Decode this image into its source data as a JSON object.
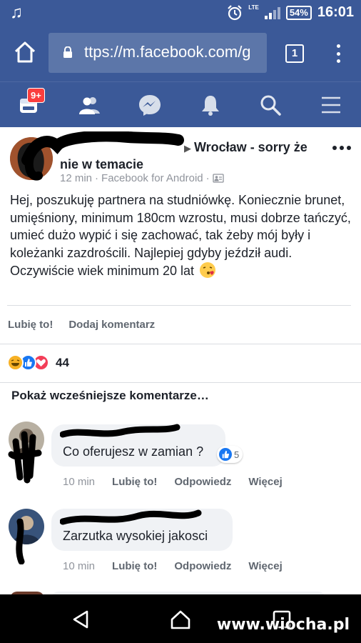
{
  "status_bar": {
    "battery": "54%",
    "network": "LTE",
    "time": "16:01"
  },
  "browser": {
    "url": "ttps://m.facebook.com/g",
    "tab_count": "1"
  },
  "fb_nav": {
    "notification_badge": "9+"
  },
  "post": {
    "group_title": "Wrocław - sorry że nie w temacie",
    "time": "12 min",
    "source": "Facebook for Android",
    "body": "Hej, poszukuję partnera na studniówkę. Koniecznie brunet, umięśniony, minimum 180cm wzrostu, musi dobrze tańczyć, umieć dużo wypić i się zachować, tak żeby mój były i koleżanki zazdrościli. Najlepiej gdyby jeździł audi. Oczywiście wiek minimum 20 lat",
    "like_label": "Lubię to!",
    "comment_label": "Dodaj komentarz",
    "reaction_count": "44"
  },
  "comments": {
    "show_earlier": "Pokaż wcześniejsze komentarze…",
    "items": [
      {
        "text": "Co oferujesz w zamian ?",
        "like_count": "5",
        "time": "10 min",
        "like": "Lubię to!",
        "reply": "Odpowiedz",
        "more": "Więcej"
      },
      {
        "text": "Zarzutka wysokiej jakosci",
        "time": "10 min",
        "like": "Lubię to!",
        "reply": "Odpowiedz",
        "more": "Więcej"
      }
    ]
  },
  "watermark": "www.wiocha.pl",
  "colors": {
    "facebook_blue": "#3b5998",
    "like_blue": "#1877f2",
    "love_red": "#f33e58",
    "haha_yellow": "#f7b125"
  }
}
